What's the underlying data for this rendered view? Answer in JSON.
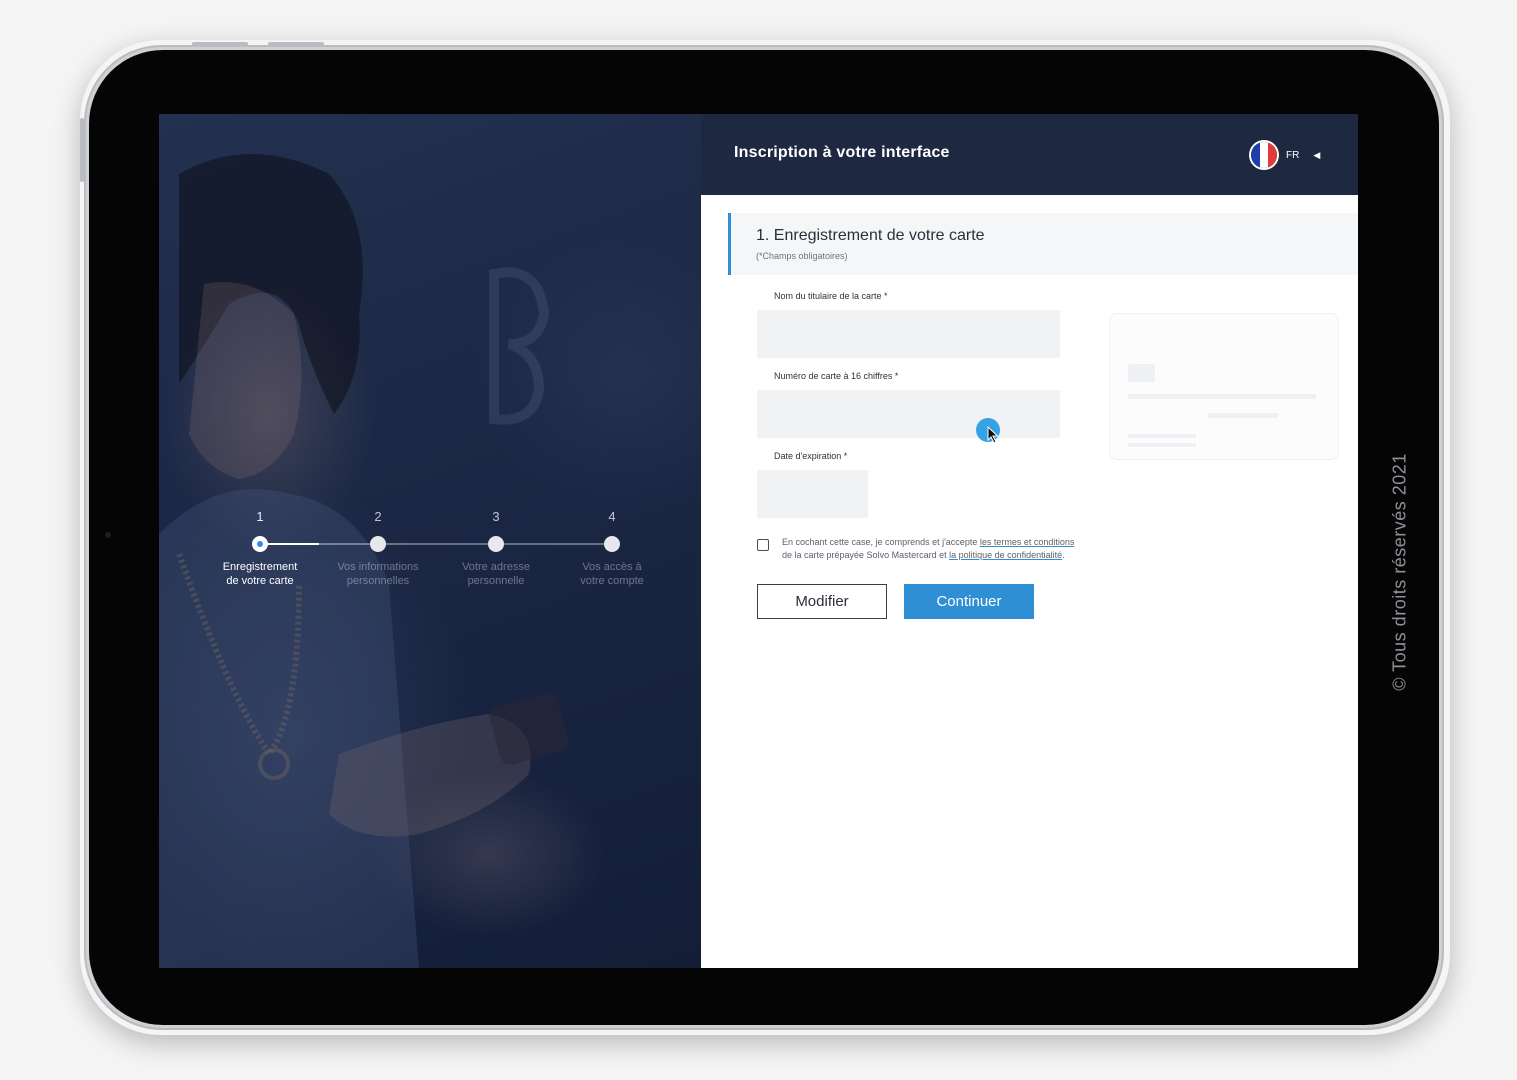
{
  "app": {
    "title": "Inscription à votre interface",
    "language": {
      "code": "FR",
      "flag_colors": [
        "#1f3fa8",
        "#ffffff",
        "#e23a3a"
      ]
    }
  },
  "stepper": {
    "active_step": 1,
    "steps": [
      {
        "number": "1",
        "label_line1": "Enregistrement",
        "label_line2": "de votre carte"
      },
      {
        "number": "2",
        "label_line1": "Vos informations",
        "label_line2": "personnelles"
      },
      {
        "number": "3",
        "label_line1": "Votre adresse",
        "label_line2": "personnelle"
      },
      {
        "number": "4",
        "label_line1": "Vos accès à",
        "label_line2": "votre compte"
      }
    ]
  },
  "form": {
    "section_title": "1. Enregistrement de votre carte",
    "section_note": "(*Champs obligatoires)",
    "fields": {
      "cardholder_name": {
        "label": "Nom du titulaire de la carte *",
        "value": ""
      },
      "card_number": {
        "label": "Numéro de carte à 16 chiffres *",
        "value": ""
      },
      "expiry_date": {
        "label": "Date d'expiration *",
        "value": ""
      }
    },
    "consent": {
      "text_before": "En cochant cette case, je comprends et j'accepte ",
      "terms_link": "les termes et conditions",
      "text_middle": "de la carte prépayée Solvo Mastercard et ",
      "privacy_link": "la politique de confidentialité",
      "text_after": ".",
      "checked": false
    },
    "buttons": {
      "modify": "Modifier",
      "continue": "Continuer"
    }
  },
  "footer": {
    "copyright": "© Tous droits réservés 2021"
  },
  "colors": {
    "accent": "#2e8fd4",
    "header_bg": "#1e2840",
    "left_panel_bg": "#1c2845",
    "input_bg": "#f1f2f4"
  }
}
